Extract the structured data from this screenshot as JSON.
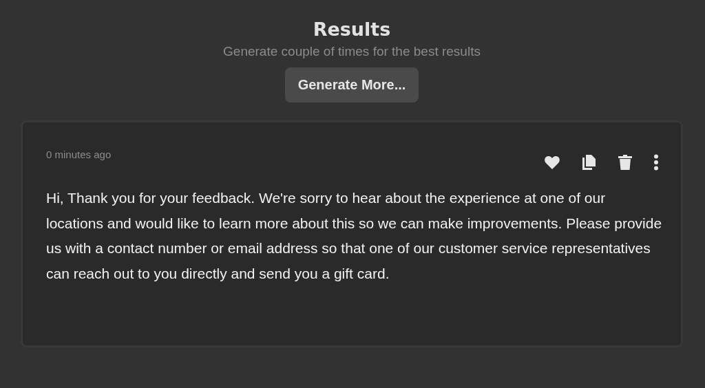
{
  "header": {
    "title": "Results",
    "subtitle": "Generate couple of times for the best results",
    "button": "Generate More..."
  },
  "result": {
    "timestamp": "0 minutes ago",
    "text": "Hi, Thank you for your feedback. We're sorry to hear about the experience at one of our locations and would like to learn more about this so we can make improvements. Please provide us with a contact number or email address so that one of our customer service representatives can reach out to you directly and send you a gift card."
  }
}
